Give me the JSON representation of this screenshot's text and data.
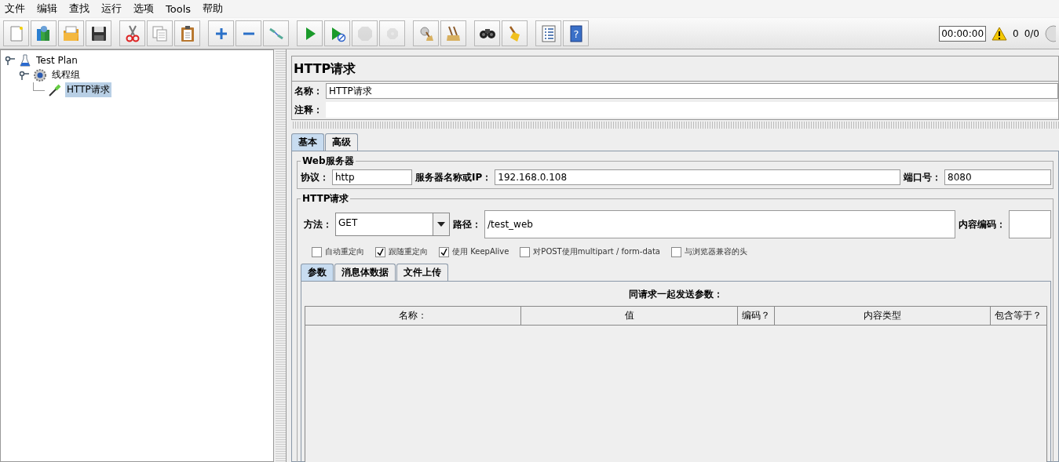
{
  "menu": [
    "文件",
    "编辑",
    "查找",
    "运行",
    "选项",
    "Tools",
    "帮助"
  ],
  "toolbar": [
    [
      {
        "kind": "new",
        "disabled": false
      },
      {
        "kind": "templates",
        "disabled": false
      },
      {
        "kind": "open",
        "disabled": false
      },
      {
        "kind": "save",
        "disabled": false
      }
    ],
    [
      {
        "kind": "cut",
        "disabled": false
      },
      {
        "kind": "copy",
        "disabled": false
      },
      {
        "kind": "paste",
        "disabled": false
      }
    ],
    [
      {
        "kind": "expand",
        "disabled": false
      },
      {
        "kind": "collapse",
        "disabled": false
      },
      {
        "kind": "toggle",
        "disabled": false
      }
    ],
    [
      {
        "kind": "start",
        "disabled": false
      },
      {
        "kind": "start-no-pause",
        "disabled": false
      },
      {
        "kind": "stop",
        "disabled": true
      },
      {
        "kind": "shutdown",
        "disabled": true
      }
    ],
    [
      {
        "kind": "clear",
        "disabled": false
      },
      {
        "kind": "clear-all",
        "disabled": false
      }
    ],
    [
      {
        "kind": "search",
        "disabled": false
      },
      {
        "kind": "reset-search",
        "disabled": false
      }
    ],
    [
      {
        "kind": "functions",
        "disabled": false
      },
      {
        "kind": "help",
        "label": "?",
        "disabled": false
      }
    ]
  ],
  "status": {
    "timer": "00:00:00",
    "warnings": "0",
    "threads": "0/0"
  },
  "tree": [
    {
      "label": "Test Plan",
      "kind": "plan",
      "expanded": true,
      "selected": false,
      "children": [
        {
          "label": "线程组",
          "kind": "threads",
          "expanded": true,
          "selected": false,
          "children": [
            {
              "label": "HTTP请求",
              "kind": "sampler",
              "selected": true
            }
          ]
        }
      ]
    }
  ],
  "sampler": {
    "title": "HTTP请求",
    "name_label": "名称：",
    "name": "HTTP请求",
    "comment_label": "注释：",
    "tabs": [
      {
        "label": "基本",
        "selected": true
      },
      {
        "label": "高级",
        "selected": false
      }
    ],
    "web_server": {
      "legend": "Web服务器",
      "protocol_label": "协议：",
      "protocol": "http",
      "server_label": "服务器名称或IP：",
      "server": "192.168.0.108",
      "port_label": "端口号：",
      "port": "8080"
    },
    "http_request": {
      "legend": "HTTP请求",
      "method_label": "方法：",
      "method": "GET",
      "path_label": "路径：",
      "path": "/test_web",
      "encoding_label": "内容编码："
    },
    "options": [
      {
        "label": "自动重定向",
        "checked": false
      },
      {
        "label": "跟随重定向",
        "checked": true
      },
      {
        "label": "使用 KeepAlive",
        "checked": true
      },
      {
        "label": "对POST使用multipart / form-data",
        "checked": false
      },
      {
        "label": "与浏览器兼容的头",
        "checked": false
      }
    ],
    "subtabs": [
      {
        "label": "参数",
        "selected": true
      },
      {
        "label": "消息体数据",
        "selected": false
      },
      {
        "label": "文件上传",
        "selected": false
      }
    ],
    "params": {
      "title": "同请求一起发送参数：",
      "columns": [
        "名称：",
        "值",
        "编码？",
        "内容类型",
        "包含等于？"
      ]
    }
  }
}
